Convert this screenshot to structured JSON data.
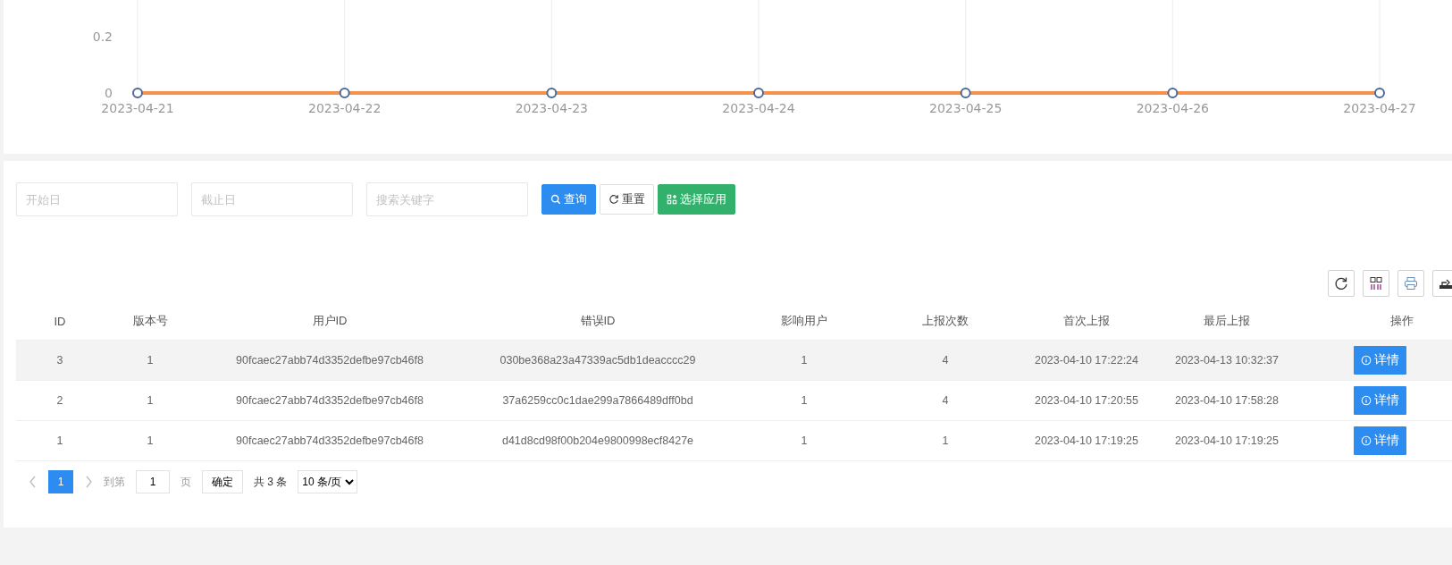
{
  "chart": {
    "chart_data": {
      "type": "line",
      "categories": [
        "2023-04-21",
        "2023-04-22",
        "2023-04-23",
        "2023-04-24",
        "2023-04-25",
        "2023-04-26",
        "2023-04-27"
      ],
      "series": [
        {
          "color": "#f5924f",
          "marker": "circle",
          "values": [
            0,
            0,
            0,
            0,
            0,
            0,
            0
          ]
        }
      ],
      "grid": {
        "x": true,
        "y": false
      },
      "ylim": [
        0,
        0.33
      ],
      "yticks": [
        0,
        0.2
      ]
    }
  },
  "filters": {
    "start_date": {
      "placeholder": "开始日"
    },
    "end_date": {
      "placeholder": "截止日"
    },
    "keyword": {
      "placeholder": "搜索关键字"
    }
  },
  "buttons": [
    {
      "kind": "search",
      "label": "查询"
    },
    {
      "kind": "reset",
      "label": "重置"
    },
    {
      "kind": "apps",
      "label": "选择应用"
    }
  ],
  "table": {
    "columns": [
      "ID",
      "版本号",
      "用户ID",
      "错误ID",
      "影响用户",
      "上报次数",
      "首次上报",
      "最后上报",
      "操作"
    ],
    "rows": [
      {
        "highlighted": true,
        "cells": [
          "3",
          "1",
          "90fcaec27abb74d3352defbe97cb46f8",
          "030be368a23a47339ac5db1deacccc29",
          "1",
          "4",
          "2023-04-10 17:22:24",
          "2023-04-13 10:32:37"
        ],
        "action": "详情"
      },
      {
        "highlighted": false,
        "cells": [
          "2",
          "1",
          "90fcaec27abb74d3352defbe97cb46f8",
          "37a6259cc0c1dae299a7866489dff0bd",
          "1",
          "4",
          "2023-04-10 17:20:55",
          "2023-04-10 17:58:28"
        ],
        "action": "详情"
      },
      {
        "highlighted": false,
        "cells": [
          "1",
          "1",
          "90fcaec27abb74d3352defbe97cb46f8",
          "d41d8cd98f00b204e9800998ecf8427e",
          "1",
          "1",
          "2023-04-10 17:19:25",
          "2023-04-10 17:19:25"
        ],
        "action": "详情"
      }
    ]
  },
  "pagination": {
    "pages": [
      {
        "label": "1",
        "selected": true
      }
    ],
    "goto_label": "到第",
    "goto_value": "1",
    "page_suffix": "页",
    "confirm": "确定",
    "total": "共 3 条",
    "page_size": "10 条/页"
  }
}
